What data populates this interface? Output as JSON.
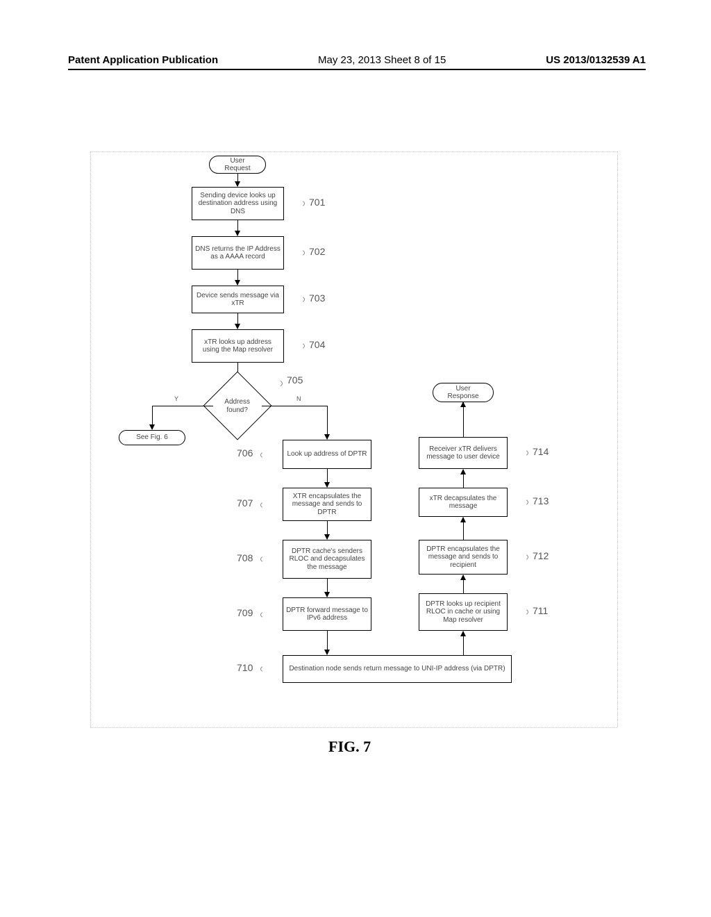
{
  "header": {
    "left": "Patent Application Publication",
    "mid": "May 23, 2013  Sheet 8 of 15",
    "right": "US 2013/0132539 A1"
  },
  "figure_label": "FIG. 7",
  "terminators": {
    "user_request": "User\nRequest",
    "see_fig6": "See Fig. 6",
    "user_response": "User\nResponse"
  },
  "decision": {
    "address_found": "Address found?"
  },
  "decision_labels": {
    "yes": "Y",
    "no": "N"
  },
  "steps": {
    "s701": "Sending device looks up destination address using DNS",
    "s702": "DNS returns the IP Address as a AAAA record",
    "s703": "Device sends message via xTR",
    "s704": "xTR looks up address using the Map resolver",
    "s706": "Look up address of DPTR",
    "s707": "XTR encapsulates the message and sends to DPTR",
    "s708": "DPTR cache's senders RLOC and decapsulates the message",
    "s709": "DPTR forward message to IPv6 address",
    "s710": "Destination node sends return message to UNI-IP address (via DPTR)",
    "s711": "DPTR looks up recipient RLOC in cache or using Map resolver",
    "s712": "DPTR encapsulates the message and sends to recipient",
    "s713": "xTR decapsulates the message",
    "s714": "Receiver xTR delivers message to user device"
  },
  "refs": {
    "r701": "701",
    "r702": "702",
    "r703": "703",
    "r704": "704",
    "r705": "705",
    "r706": "706",
    "r707": "707",
    "r708": "708",
    "r709": "709",
    "r710": "710",
    "r711": "711",
    "r712": "712",
    "r713": "713",
    "r714": "714"
  },
  "chart_data": {
    "type": "flowchart",
    "title": "FIG. 7",
    "nodes": [
      {
        "id": "start",
        "type": "terminator",
        "text": "User Request"
      },
      {
        "id": "701",
        "type": "process",
        "text": "Sending device looks up destination address using DNS"
      },
      {
        "id": "702",
        "type": "process",
        "text": "DNS returns the IP Address as a AAAA record"
      },
      {
        "id": "703",
        "type": "process",
        "text": "Device sends message via xTR"
      },
      {
        "id": "704",
        "type": "process",
        "text": "xTR looks up address using the Map resolver"
      },
      {
        "id": "705",
        "type": "decision",
        "text": "Address found?"
      },
      {
        "id": "fig6",
        "type": "terminator",
        "text": "See Fig. 6"
      },
      {
        "id": "706",
        "type": "process",
        "text": "Look up address of DPTR"
      },
      {
        "id": "707",
        "type": "process",
        "text": "XTR encapsulates the message and sends to DPTR"
      },
      {
        "id": "708",
        "type": "process",
        "text": "DPTR cache's senders RLOC and decapsulates the message"
      },
      {
        "id": "709",
        "type": "process",
        "text": "DPTR forward message to IPv6 address"
      },
      {
        "id": "710",
        "type": "process",
        "text": "Destination node sends return message to UNI-IP address (via DPTR)"
      },
      {
        "id": "711",
        "type": "process",
        "text": "DPTR looks up recipient RLOC in cache or using Map resolver"
      },
      {
        "id": "712",
        "type": "process",
        "text": "DPTR encapsulates the message and sends to recipient"
      },
      {
        "id": "713",
        "type": "process",
        "text": "xTR decapsulates the message"
      },
      {
        "id": "714",
        "type": "process",
        "text": "Receiver xTR delivers message to user device"
      },
      {
        "id": "end",
        "type": "terminator",
        "text": "User Response"
      }
    ],
    "edges": [
      {
        "from": "start",
        "to": "701"
      },
      {
        "from": "701",
        "to": "702"
      },
      {
        "from": "702",
        "to": "703"
      },
      {
        "from": "703",
        "to": "704"
      },
      {
        "from": "704",
        "to": "705"
      },
      {
        "from": "705",
        "to": "fig6",
        "label": "Y"
      },
      {
        "from": "705",
        "to": "706",
        "label": "N"
      },
      {
        "from": "706",
        "to": "707"
      },
      {
        "from": "707",
        "to": "708"
      },
      {
        "from": "708",
        "to": "709"
      },
      {
        "from": "709",
        "to": "710"
      },
      {
        "from": "710",
        "to": "711"
      },
      {
        "from": "711",
        "to": "712"
      },
      {
        "from": "712",
        "to": "713"
      },
      {
        "from": "713",
        "to": "714"
      },
      {
        "from": "714",
        "to": "end"
      }
    ]
  }
}
